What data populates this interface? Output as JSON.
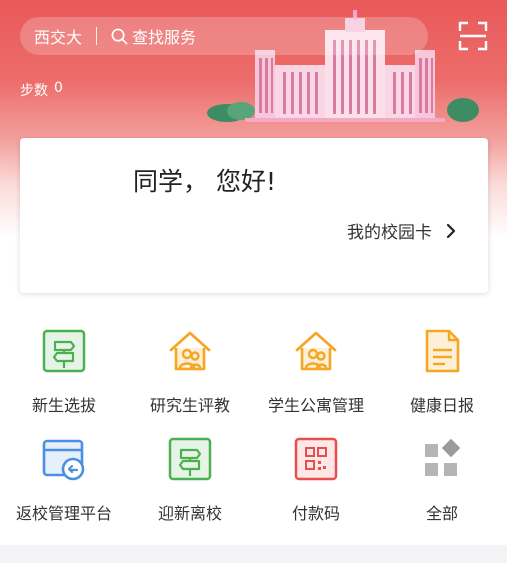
{
  "header": {
    "school": "西交大",
    "search_placeholder": "查找服务",
    "steps_label": "步数",
    "steps_value": "0"
  },
  "card": {
    "greeting": "同学， 您好!",
    "campus_card": "我的校园卡"
  },
  "services": [
    {
      "label": "新生选拔",
      "icon": "signpost-icon",
      "color": "#4caf50"
    },
    {
      "label": "研究生评教",
      "icon": "house-people-icon",
      "color": "#f5a623"
    },
    {
      "label": "学生公寓管理",
      "icon": "house-people-icon",
      "color": "#f5a623"
    },
    {
      "label": "健康日报",
      "icon": "document-icon",
      "color": "#f5a623"
    },
    {
      "label": "返校管理平台",
      "icon": "calendar-return-icon",
      "color": "#4a90e2"
    },
    {
      "label": "迎新离校",
      "icon": "signpost-icon",
      "color": "#4caf50"
    },
    {
      "label": "付款码",
      "icon": "qr-code-icon",
      "color": "#e94e4e"
    },
    {
      "label": "全部",
      "icon": "all-apps-icon",
      "color": "#9b9b9b"
    }
  ],
  "colors": {
    "accent_red": "#e9595a",
    "green": "#4caf50",
    "orange": "#f5a623",
    "blue": "#4a90e2",
    "gray": "#9b9b9b"
  }
}
